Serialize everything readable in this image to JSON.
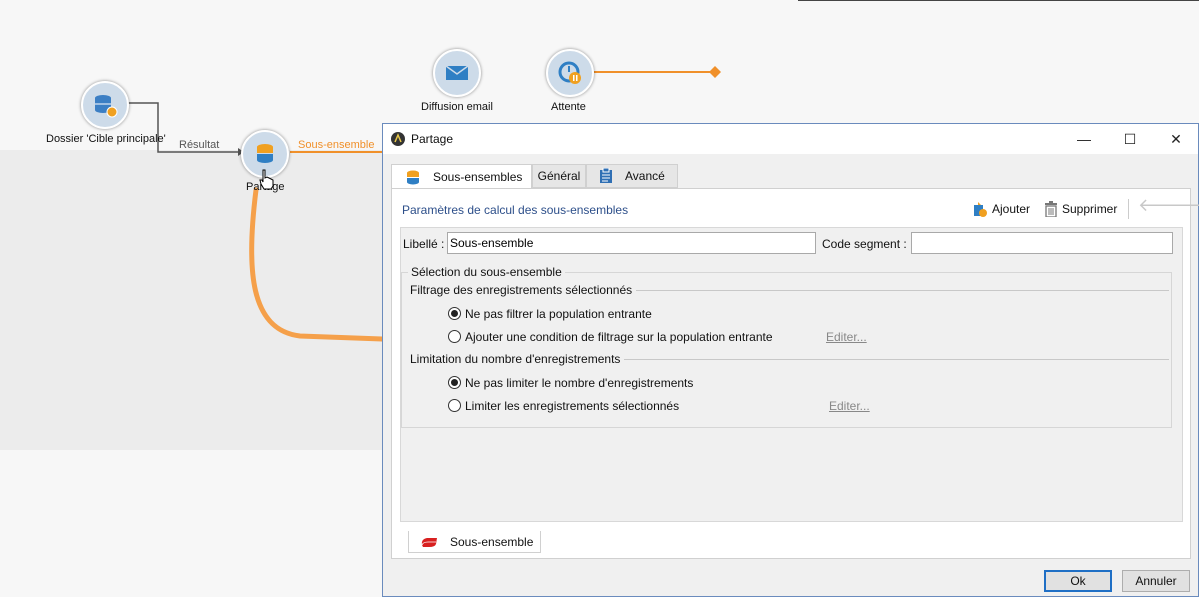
{
  "workflow": {
    "nodes": {
      "dossier": {
        "label": "Dossier 'Cible principale'"
      },
      "partage": {
        "label": "Partage"
      },
      "diffusion": {
        "label": "Diffusion email"
      },
      "attente": {
        "label": "Attente"
      }
    },
    "edges": {
      "resultat": "Résultat",
      "sous_ensemble": "Sous-ensemble"
    },
    "colors": {
      "accent": "#f0902a",
      "node_fill": "#cddbe9",
      "link_blue": "#2d4f8a"
    }
  },
  "dialog": {
    "title": "Partage",
    "window_buttons": {
      "minimize": "—",
      "maximize": "☐",
      "close": "✕"
    },
    "tabs": [
      {
        "label": "Sous-ensembles",
        "icon": "database-icon",
        "active": true
      },
      {
        "label": "Général",
        "active": false
      },
      {
        "label": "Avancé",
        "icon": "clipboard-icon",
        "active": false
      }
    ],
    "panel_header": "Paramètres de calcul des sous-ensembles",
    "toolbar": {
      "add_label": "Ajouter",
      "delete_label": "Supprimer"
    },
    "fields": {
      "libelle_label": "Libellé :",
      "libelle_value": "Sous-ensemble",
      "code_segment_label": "Code segment :",
      "code_segment_value": ""
    },
    "selection_group": {
      "legend": "Sélection du sous-ensemble",
      "filtering": {
        "title": "Filtrage des enregistrements sélectionnés",
        "option1": "Ne pas filtrer la population entrante",
        "option2": "Ajouter une condition de filtrage sur la population entrante",
        "edit_link": "Editer...",
        "selected": 1
      },
      "limitation": {
        "title": "Limitation du nombre d'enregistrements",
        "option1": "Ne pas limiter le nombre d'enregistrements",
        "option2": "Limiter les enregistrements sélectionnés",
        "edit_link": "Editer...",
        "selected": 1
      }
    },
    "bottom_tab": "Sous-ensemble",
    "buttons": {
      "ok": "Ok",
      "cancel": "Annuler"
    }
  }
}
